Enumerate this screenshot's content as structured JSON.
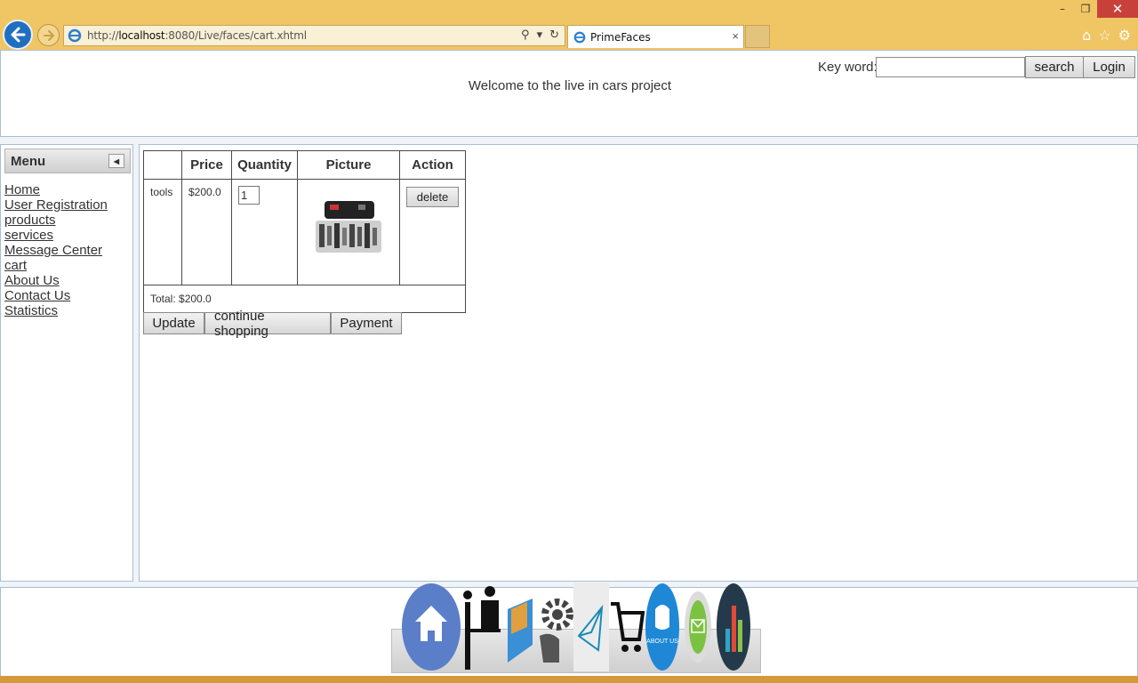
{
  "browser": {
    "url_prefix": "http://",
    "url_host": "localhost",
    "url_rest": ":8080/Live/faces/cart.xhtml",
    "tab_title": "PrimeFaces",
    "tab_close": "×",
    "window": {
      "minimize": "–",
      "restore": "❐",
      "close": "✕"
    }
  },
  "header": {
    "keyword_label": "Key word:",
    "keyword_value": "",
    "search_button": "search",
    "login_button": "Login",
    "welcome": "Welcome to the live in cars project"
  },
  "menu": {
    "title": "Menu",
    "items": [
      "Home",
      "User Registration",
      "products",
      "services",
      "Message Center",
      "cart",
      "About Us",
      "Contact Us",
      "Statistics"
    ]
  },
  "cart": {
    "columns": [
      "",
      "Price",
      "Quantity",
      "Picture",
      "Action"
    ],
    "rows": [
      {
        "name": "tools",
        "price": "$200.0",
        "quantity": "1",
        "picture": "toolkit-image",
        "action": "delete"
      }
    ],
    "total": "Total: $200.0",
    "buttons": {
      "update": "Update",
      "continue": "continue shopping",
      "payment": "Payment"
    }
  },
  "dock": {
    "icons": [
      "home-icon",
      "user-registration-icon",
      "products-box-icon",
      "services-gear-icon",
      "message-icon",
      "cart-icon",
      "about-us-icon",
      "contact-us-icon",
      "statistics-icon"
    ],
    "about_text": "ABOUT US"
  },
  "colors": {
    "chrome": "#f0c564",
    "panel_border": "#a8bfd1",
    "back_button": "#1f6fc1"
  }
}
